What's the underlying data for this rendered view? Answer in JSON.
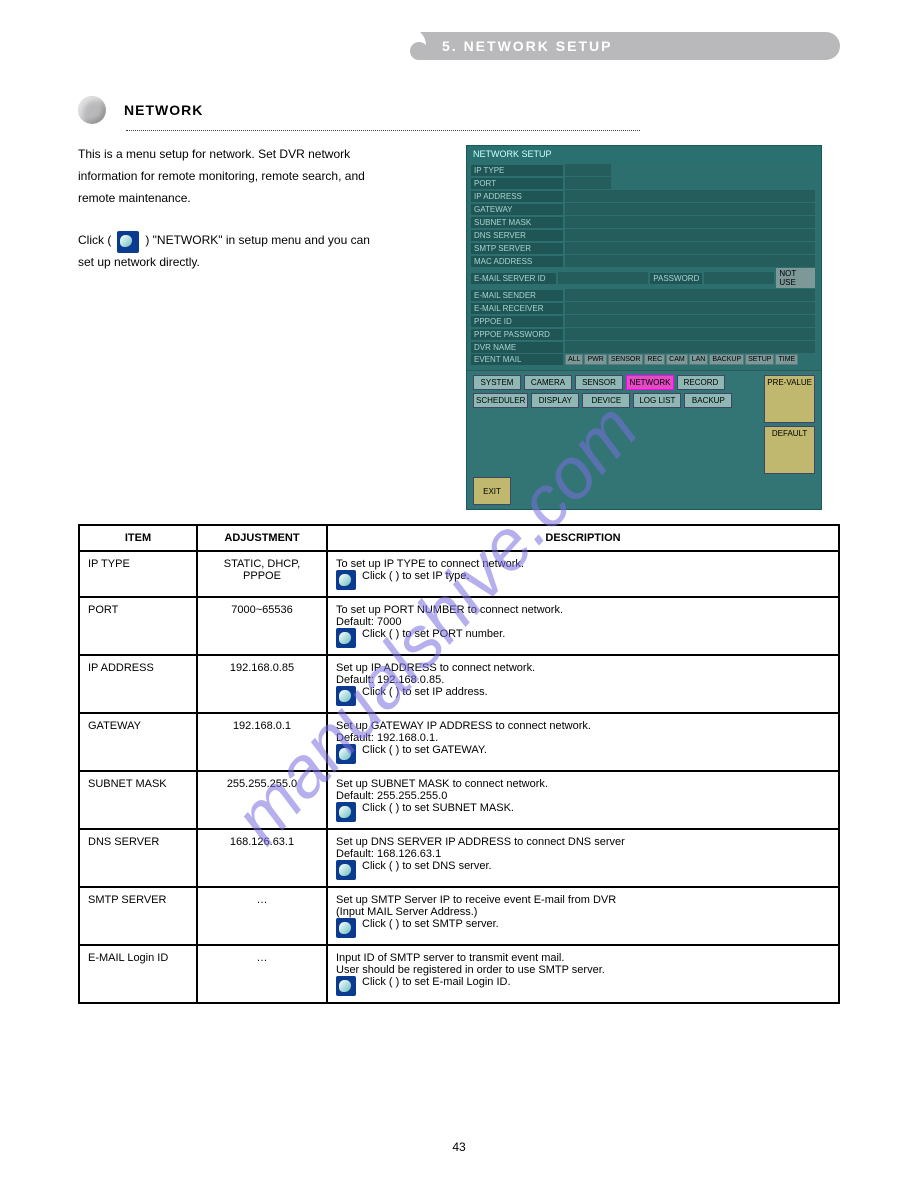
{
  "header": {
    "title": "5. NETWORK SETUP"
  },
  "section": {
    "title": "NETWORK"
  },
  "intro": {
    "line1": "This is a menu setup for network. Set DVR network",
    "line2": "information for remote monitoring, remote search, and",
    "line3": "remote maintenance.",
    "mouse_prefix": "",
    "mouse_suffix": "Click (      ) \"NETWORK\" in setup menu and you can",
    "line5": "set up network directly."
  },
  "screenshot": {
    "title": "NETWORK SETUP",
    "rows": [
      "IP TYPE",
      "PORT",
      "IP ADDRESS",
      "GATEWAY",
      "SUBNET MASK",
      "DNS SERVER",
      "SMTP SERVER",
      "MAC ADDRESS"
    ],
    "email_row_label": "E-MAIL SERVER ID",
    "password_label": "PASSWORD",
    "notuse": "NOT USE",
    "rows2": [
      "E-MAIL SENDER",
      "E-MAIL RECEIVER",
      "PPPOE ID",
      "PPPOE PASSWORD",
      "DVR NAME"
    ],
    "event_label": "EVENT MAIL",
    "event_btns": [
      "ALL",
      "PWR",
      "SENSOR",
      "REC",
      "CAM",
      "LAN",
      "BACKUP",
      "SETUP",
      "TIME"
    ],
    "nav1": [
      "SYSTEM",
      "CAMERA",
      "SENSOR",
      "NETWORK",
      "RECORD"
    ],
    "nav2": [
      "SCHEDULER",
      "DISPLAY",
      "DEVICE",
      "LOG LIST",
      "BACKUP"
    ],
    "side": [
      "PRE-VALUE",
      "DEFAULT"
    ],
    "exit": "EXIT"
  },
  "table": {
    "h1": "ITEM",
    "h2": "ADJUSTMENT",
    "h3": "DESCRIPTION",
    "rows": [
      {
        "c1": "IP TYPE",
        "c2": "STATIC, DHCP, PPPOE",
        "d1": "To set up IP TYPE to connect network.",
        "m": "Click (      ) to set IP type."
      },
      {
        "c1": "PORT",
        "c2": "7000~65536",
        "d1": "To set up PORT NUMBER to connect network.",
        "d2": "Default: 7000",
        "m": "Click (      ) to set PORT number."
      },
      {
        "c1": "IP ADDRESS",
        "c2": "192.168.0.85",
        "d1": "Set up IP ADDRESS to connect network.",
        "d2": "Default: 192.168.0.85.",
        "m": "Click (      ) to set IP address."
      },
      {
        "c1": "GATEWAY",
        "c2": "192.168.0.1",
        "d1": "Set up GATEWAY IP ADDRESS to connect network.",
        "d2": "Default: 192.168.0.1.",
        "m": "Click (      ) to set GATEWAY."
      },
      {
        "c1": "SUBNET MASK",
        "c2": "255.255.255.0",
        "d1": "Set up SUBNET MASK to connect network.",
        "d2": "Default: 255.255.255.0",
        "m": "Click (      ) to set SUBNET MASK."
      },
      {
        "c1": "DNS SERVER",
        "c2": "168.126.63.1",
        "d1": "Set up DNS SERVER IP ADDRESS to connect DNS server",
        "d2": "Default: 168.126.63.1",
        "m": "Click (      ) to set DNS server."
      },
      {
        "c1": "SMTP SERVER",
        "c2": "…",
        "d1": "Set up SMTP Server IP to receive event E-mail from DVR",
        "d2": "(Input MAIL Server Address.)",
        "m": "Click (      ) to set SMTP server."
      },
      {
        "c1": "E-MAIL Login ID",
        "c2": "…",
        "d1": "Input ID of SMTP server to transmit event mail.",
        "d2": "User should be registered in order to use SMTP server.",
        "m": "Click (      ) to set E-mail Login ID."
      }
    ]
  },
  "footer": "43",
  "watermark": "manualshive.com"
}
